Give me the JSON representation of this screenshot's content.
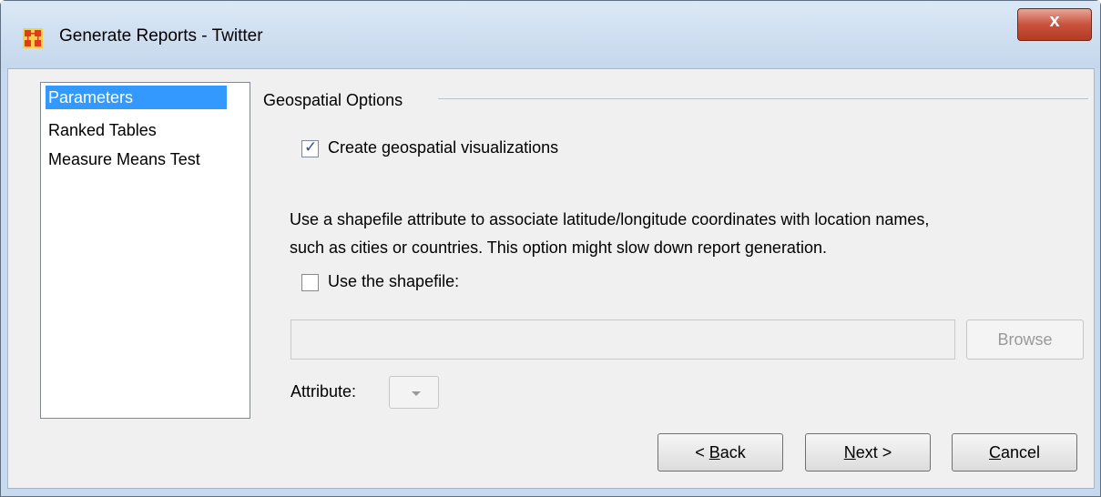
{
  "window": {
    "title": "Generate Reports - Twitter",
    "close_glyph": "x"
  },
  "nav": {
    "items": [
      {
        "label": "Parameters",
        "selected": true
      },
      {
        "label": "Ranked Tables",
        "selected": false
      },
      {
        "label": "Measure Means Test",
        "selected": false
      }
    ]
  },
  "geospatial": {
    "group_title": "Geospatial Options",
    "create_viz": {
      "label": "Create geospatial visualizations",
      "checked": true
    },
    "description_line1": "Use a shapefile attribute to associate latitude/longitude coordinates with location names,",
    "description_line2": "such as cities or countries. This option might slow down report generation.",
    "use_shapefile": {
      "label": "Use the shapefile:",
      "checked": false
    },
    "shapefile_path": "",
    "browse_label": "Browse",
    "attribute_label": "Attribute:",
    "attribute_value": ""
  },
  "footer": {
    "back_prefix": "< ",
    "back_mnemonic": "B",
    "back_rest": "ack",
    "next_mnemonic": "N",
    "next_rest": "ext >",
    "cancel_mnemonic": "C",
    "cancel_rest": "ancel"
  },
  "icons": {
    "app": "org-chart-icon",
    "close": "close-icon",
    "dropdown": "chevron-down-icon"
  },
  "colors": {
    "selection": "#3399ff",
    "close_button": "#c8523c",
    "frame": "#c7d9ee"
  }
}
